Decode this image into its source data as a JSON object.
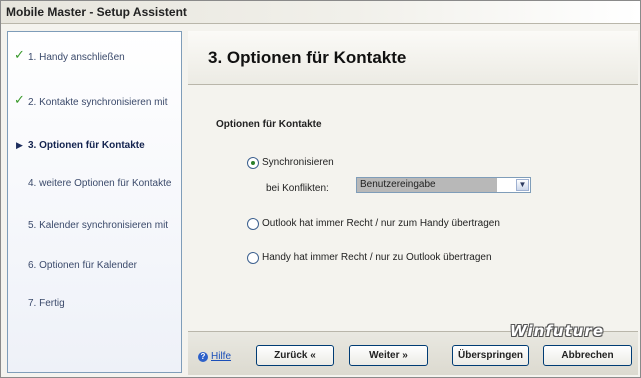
{
  "window": {
    "title": "Mobile Master - Setup Assistent"
  },
  "sidebar": {
    "steps": [
      {
        "label": "1. Handy anschließen",
        "state": "done",
        "icon": "checkmark-icon"
      },
      {
        "label": "2. Kontakte synchronisieren mit",
        "state": "done",
        "icon": "checkmark-icon"
      },
      {
        "label": "3. Optionen für Kontakte",
        "state": "current",
        "icon": "arrow-right-icon"
      },
      {
        "label": "4. weitere Optionen für Kontakte",
        "state": "todo"
      },
      {
        "label": "5. Kalender synchronisieren mit",
        "state": "todo"
      },
      {
        "label": "6. Optionen für Kalender",
        "state": "todo"
      },
      {
        "label": "7. Fertig",
        "state": "todo"
      }
    ]
  },
  "header": {
    "title": "3. Optionen für Kontakte"
  },
  "content": {
    "section_title": "Optionen für Kontakte",
    "options": [
      {
        "label": "Synchronisieren",
        "checked": true
      },
      {
        "label": "Outlook hat immer Recht / nur zum Handy übertragen",
        "checked": false
      },
      {
        "label": "Handy hat immer Recht / nur zu Outlook übertragen",
        "checked": false
      }
    ],
    "conflict_label": "bei Konflikten:",
    "conflict_select_value": "Benutzereingabe"
  },
  "footer": {
    "help_label": "Hilfe",
    "back_label": "Zurück «",
    "next_label": "Weiter »",
    "skip_label": "Überspringen",
    "cancel_label": "Abbrechen"
  },
  "watermark": "Winfuture",
  "colors": {
    "check_green": "#3a9a2c",
    "link_blue": "#1b4fb8",
    "sidebar_border": "#7f9db9"
  }
}
